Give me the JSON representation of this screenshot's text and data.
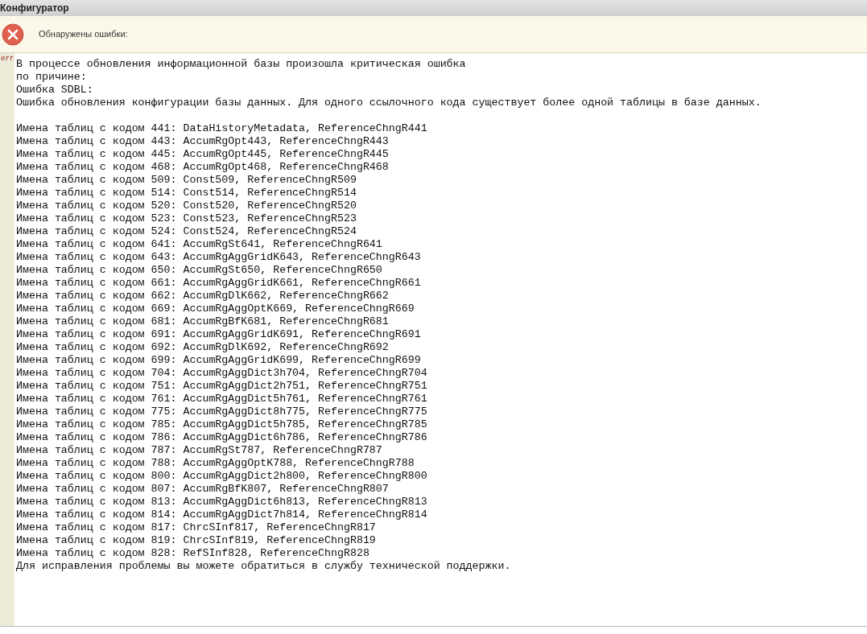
{
  "window": {
    "title": "Конфигуратор"
  },
  "header": {
    "message": "Обнаружены ошибки:"
  },
  "log": {
    "marker": "err",
    "paragraphs": [
      [
        "В процессе обновления информационной базы произошла критическая ошибка",
        "по причине:",
        "Ошибка SDBL:",
        "Ошибка обновления конфигурации базы данных. Для одного ссылочного кода существует более одной таблицы в базе данных."
      ],
      [
        "Имена таблиц с кодом 441: DataHistoryMetadata, ReferenceChngR441",
        "Имена таблиц с кодом 443: AccumRgOpt443, ReferenceChngR443",
        "Имена таблиц с кодом 445: AccumRgOpt445, ReferenceChngR445",
        "Имена таблиц с кодом 468: AccumRgOpt468, ReferenceChngR468",
        "Имена таблиц с кодом 509: Const509, ReferenceChngR509",
        "Имена таблиц с кодом 514: Const514, ReferenceChngR514",
        "Имена таблиц с кодом 520: Const520, ReferenceChngR520",
        "Имена таблиц с кодом 523: Const523, ReferenceChngR523",
        "Имена таблиц с кодом 524: Const524, ReferenceChngR524",
        "Имена таблиц с кодом 641: AccumRgSt641, ReferenceChngR641",
        "Имена таблиц с кодом 643: AccumRgAggGridK643, ReferenceChngR643",
        "Имена таблиц с кодом 650: AccumRgSt650, ReferenceChngR650",
        "Имена таблиц с кодом 661: AccumRgAggGridK661, ReferenceChngR661",
        "Имена таблиц с кодом 662: AccumRgDlK662, ReferenceChngR662",
        "Имена таблиц с кодом 669: AccumRgAggOptK669, ReferenceChngR669",
        "Имена таблиц с кодом 681: AccumRgBfK681, ReferenceChngR681",
        "Имена таблиц с кодом 691: AccumRgAggGridK691, ReferenceChngR691",
        "Имена таблиц с кодом 692: AccumRgDlK692, ReferenceChngR692",
        "Имена таблиц с кодом 699: AccumRgAggGridK699, ReferenceChngR699",
        "Имена таблиц с кодом 704: AccumRgAggDict3h704, ReferenceChngR704",
        "Имена таблиц с кодом 751: AccumRgAggDict2h751, ReferenceChngR751",
        "Имена таблиц с кодом 761: AccumRgAggDict5h761, ReferenceChngR761",
        "Имена таблиц с кодом 775: AccumRgAggDict8h775, ReferenceChngR775",
        "Имена таблиц с кодом 785: AccumRgAggDict5h785, ReferenceChngR785",
        "Имена таблиц с кодом 786: AccumRgAggDict6h786, ReferenceChngR786",
        "Имена таблиц с кодом 787: AccumRgSt787, ReferenceChngR787",
        "Имена таблиц с кодом 788: AccumRgAggOptK788, ReferenceChngR788",
        "Имена таблиц с кодом 800: AccumRgAggDict2h800, ReferenceChngR800",
        "Имена таблиц с кодом 807: AccumRgBfK807, ReferenceChngR807",
        "Имена таблиц с кодом 813: AccumRgAggDict6h813, ReferenceChngR813",
        "Имена таблиц с кодом 814: AccumRgAggDict7h814, ReferenceChngR814",
        "Имена таблиц с кодом 817: ChrcSInf817, ReferenceChngR817",
        "Имена таблиц с кодом 819: ChrcSInf819, ReferenceChngR819",
        "Имена таблиц с кодом 828: RefSInf828, ReferenceChngR828",
        "Для исправления проблемы вы можете обратиться в службу технической поддержки."
      ]
    ]
  }
}
